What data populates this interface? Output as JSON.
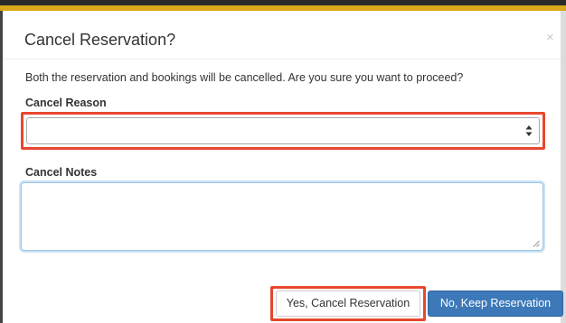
{
  "dialog": {
    "title": "Cancel Reservation?",
    "close_glyph": "×",
    "message": "Both the reservation and bookings will be cancelled. Are you sure you want to proceed?"
  },
  "form": {
    "cancel_reason": {
      "label": "Cancel Reason",
      "selected_value": "",
      "icon": "select-arrows-icon"
    },
    "cancel_notes": {
      "label": "Cancel Notes",
      "value": "",
      "placeholder": ""
    }
  },
  "buttons": {
    "confirm_label": "Yes, Cancel Reservation",
    "keep_label": "No, Keep Reservation"
  },
  "colors": {
    "highlight": "#e8472f",
    "primary_button": "#3d79b8",
    "accent_top_bar": "#d9a81a",
    "focus_ring": "#9ec5e4"
  }
}
